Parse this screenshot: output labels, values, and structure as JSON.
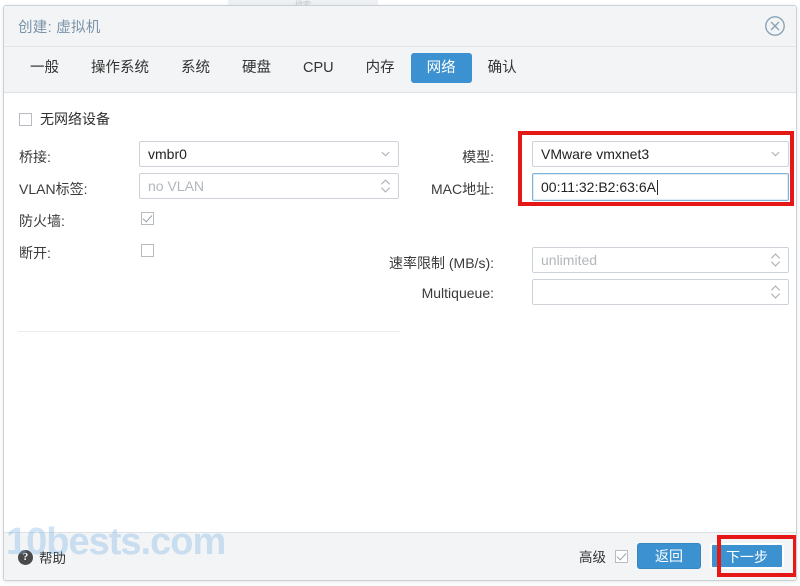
{
  "backdrop": {
    "strip_text": "搜索"
  },
  "dialog": {
    "title": "创建: 虚拟机",
    "close_icon": "close-circle-icon",
    "tabs": [
      {
        "label": "一般",
        "active": false
      },
      {
        "label": "操作系统",
        "active": false
      },
      {
        "label": "系统",
        "active": false
      },
      {
        "label": "硬盘",
        "active": false
      },
      {
        "label": "CPU",
        "active": false
      },
      {
        "label": "内存",
        "active": false
      },
      {
        "label": "网络",
        "active": true
      },
      {
        "label": "确认",
        "active": false
      }
    ],
    "active_tab": "网络",
    "accent_color": "#3c92d0",
    "highlight_color": "#e61717"
  },
  "form": {
    "no_network_device": {
      "label": "无网络设备",
      "checked": false
    },
    "bridge": {
      "label": "桥接:",
      "value": "vmbr0",
      "control": "select"
    },
    "vlan_tag": {
      "label": "VLAN标签:",
      "value": "",
      "placeholder": "no VLAN",
      "control": "spinner"
    },
    "firewall": {
      "label": "防火墙:",
      "checked": true
    },
    "disconnect": {
      "label": "断开:",
      "checked": false
    },
    "model": {
      "label": "模型:",
      "value": "VMware vmxnet3",
      "control": "select",
      "highlighted": true
    },
    "mac_address": {
      "label": "MAC地址:",
      "value": "00:11:32:B2:63:6A",
      "control": "text",
      "focused": true,
      "highlighted": true
    },
    "rate_limit": {
      "label": "速率限制 (MB/s):",
      "value": "",
      "placeholder": "unlimited",
      "control": "spinner"
    },
    "multiqueue": {
      "label": "Multiqueue:",
      "value": "",
      "placeholder": "",
      "control": "spinner"
    }
  },
  "footer": {
    "help_label": "帮助",
    "help_icon": "question-mark-icon",
    "advanced_label": "高级",
    "advanced_checked": true,
    "back_label": "返回",
    "next_label": "下一步",
    "next_highlighted": true
  },
  "watermark": {
    "text": "10bests.com"
  }
}
